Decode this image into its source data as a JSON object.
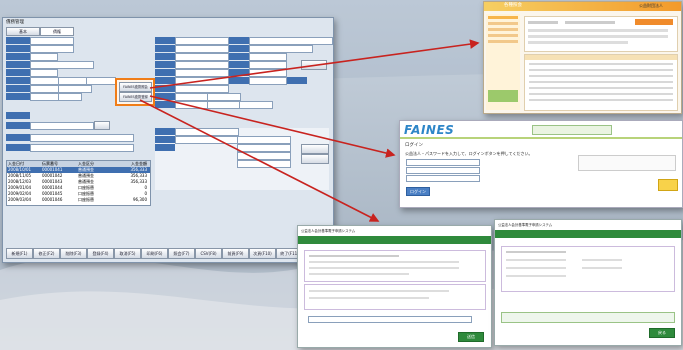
{
  "colors": {
    "accent_red": "#c8231f",
    "orange_highlight": "#f07d18",
    "blue_label": "#3f6fb0",
    "green_header": "#2f8a3c",
    "faines_blue": "#2e86c8"
  },
  "main_window": {
    "title": "債務管理",
    "tabs": [
      "基本",
      "債権"
    ],
    "orange_box": [
      "FAINES連携照会",
      "FAINES連携登録"
    ],
    "list_headers": [
      "入金日付",
      "伝票番号",
      "入金区分",
      "入金金額"
    ],
    "list_rows": [
      [
        "2008/10/01",
        "00001041",
        "普通預金",
        "356,333"
      ],
      [
        "2008/11/05",
        "00001042",
        "普通預金",
        "356,333"
      ],
      [
        "2008/12/03",
        "00001043",
        "普通預金",
        "356,333"
      ],
      [
        "2009/01/04",
        "00001044",
        "口座振替",
        "0"
      ],
      [
        "2009/02/04",
        "00001045",
        "口座振替",
        "0"
      ],
      [
        "2009/03/04",
        "00001046",
        "口座振替",
        "96,300"
      ]
    ],
    "footer_buttons": [
      "新規(F1)",
      "修正(F2)",
      "削除(F3)",
      "登録(F4)",
      "取消(F5)",
      "印刷(F6)",
      "照会(F7)",
      "CSV(F8)",
      "前頁(F9)",
      "次頁(F10)",
      "終了(F11)",
      "閉じる(F12)"
    ]
  },
  "top_right_window": {
    "title": "各種照会",
    "brand": "公益財団法人"
  },
  "faines": {
    "logo": "FAINES",
    "section_title": "ログイン",
    "instruction": "公益法人・パスワードを入力して、ログインボタンを押してください。",
    "login_button": "ログイン"
  },
  "bottom_windows": {
    "left_title": "公益法人会計基準電子申請システム",
    "right_title": "公益法人会計基準電子申請システム",
    "left_button": "送信",
    "right_button": "戻る"
  }
}
